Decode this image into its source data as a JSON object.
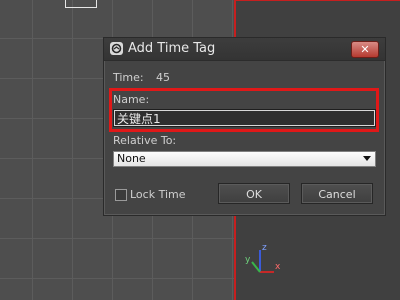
{
  "dialog": {
    "title": "Add Time Tag",
    "close_label": "✕",
    "time_label": "Time:",
    "time_value": "45",
    "name_label": "Name:",
    "name_value": "关键点1",
    "relative_label": "Relative To:",
    "relative_value": "None",
    "lock_time_label": "Lock Time",
    "lock_time_checked": false,
    "ok_label": "OK",
    "cancel_label": "Cancel"
  },
  "viewport": {
    "gizmo_labels": {
      "z": "z",
      "x": "x",
      "y": "y"
    }
  },
  "colors": {
    "highlight": "#e01818",
    "viewport_border": "#c61f1f"
  },
  "icons": {
    "app": "3dsmax-logo-icon",
    "dropdown": "chevron-down-icon",
    "close": "close-icon"
  }
}
